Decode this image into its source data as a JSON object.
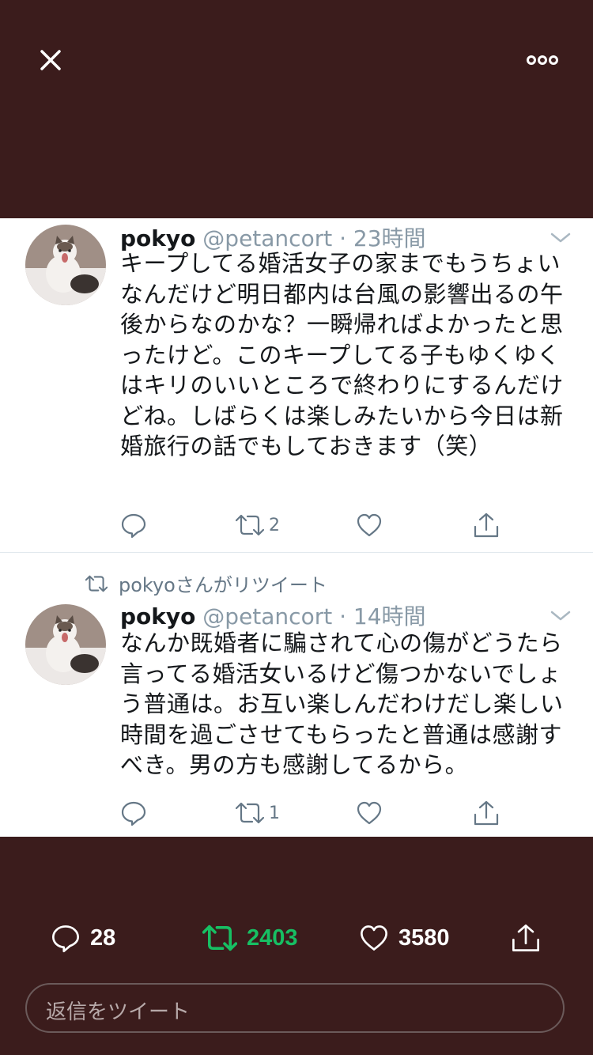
{
  "top_bar": {
    "close_icon": "close-icon",
    "more_icon": "more-options-icon"
  },
  "tweets": [
    {
      "name": "pokyo",
      "handle": "@petancort",
      "time": "23時間",
      "body": "キープしてる婚活女子の家までもうちょいなんだけど明日都内は台風の影響出るの午後からなのかな？一瞬帰ればよかったと思ったけど。このキープしてる子もゆくゆくはキリのいいところで終わりにするんだけどね。しばらくは楽しみたいから今日は新婚旅行の話でもしておきます（笑）",
      "retweet_count": "2",
      "reply_count": "",
      "like_count": ""
    },
    {
      "retweet_context": "pokyoさんがリツイート",
      "name": "pokyo",
      "handle": "@petancort",
      "time": "14時間",
      "body": "なんか既婚者に騙されて心の傷がどうたら言ってる婚活女いるけど傷つかないでしょう普通は。お互い楽しんだわけだし楽しい時間を過ごさせてもらったと普通は感謝すべき。男の方も感謝してるから。",
      "retweet_count": "1",
      "reply_count": "",
      "like_count": ""
    }
  ],
  "bottom_bar": {
    "reply_count": "28",
    "retweet_count": "2403",
    "like_count": "3580",
    "retweet_active_color": "#17bf63",
    "reply_placeholder": "返信をツイート"
  }
}
